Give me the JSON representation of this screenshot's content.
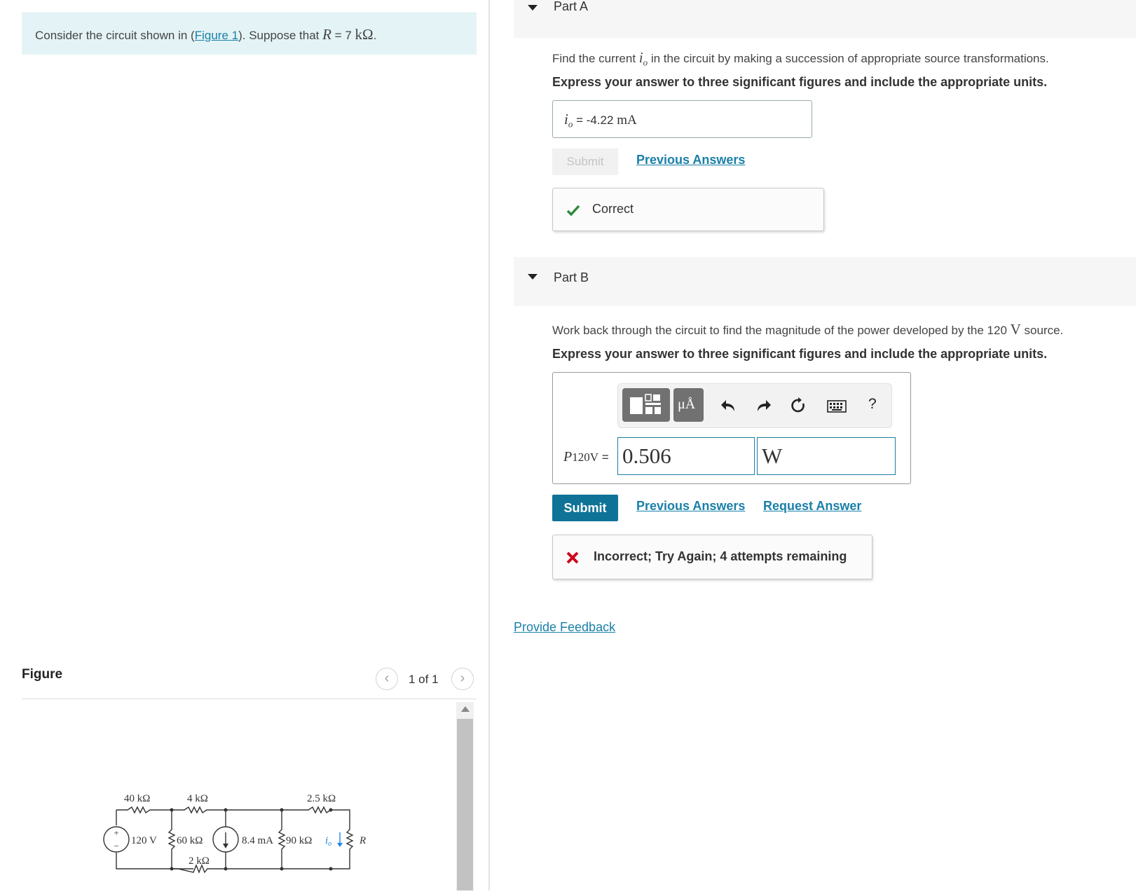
{
  "intro": {
    "text_before": "Consider the circuit shown in (",
    "figure_link": "Figure 1",
    "text_mid": "). Suppose that ",
    "var": "R",
    "text_eq": " = 7 ",
    "unit": "kΩ",
    "text_end": "."
  },
  "figure_panel": {
    "title": "Figure",
    "prev_icon": "chevron-left-icon",
    "next_icon": "chevron-right-icon",
    "counter": "1 of 1"
  },
  "circuit": {
    "r1": "40 kΩ",
    "r2": "4 kΩ",
    "r3": "2.5 kΩ",
    "vsrc": "120 V",
    "r4": "60 kΩ",
    "r5": "2 kΩ",
    "isrc": "8.4 mA",
    "r6": "90 kΩ",
    "io": "i",
    "io_sub": "o",
    "rload": "R"
  },
  "partA": {
    "title": "Part A",
    "question_before": "Find the current ",
    "question_var": "i",
    "question_sub": "o",
    "question_after": " in the circuit by making a succession of appropriate source transformations.",
    "instructions": "Express your answer to three significant figures and include the appropriate units.",
    "answer_var": "i",
    "answer_sub": "o",
    "answer_eq": " = ",
    "answer_value": "-4.22",
    "answer_unit": " mA",
    "submit_label": "Submit",
    "previous_answers": "Previous Answers",
    "feedback_icon": "checkmark-icon",
    "feedback": "Correct"
  },
  "partB": {
    "title": "Part B",
    "question_before": "Work back through the circuit to find the magnitude of the power developed by the 120 ",
    "question_unit": "V",
    "question_after": " source.",
    "instructions": "Express your answer to three significant figures and include the appropriate units.",
    "toolbar": {
      "templates_icon": "templates-icon",
      "units_label": "μÅ",
      "undo_icon": "undo-icon",
      "redo_icon": "redo-icon",
      "reset_icon": "reset-icon",
      "keyboard_icon": "keyboard-icon",
      "help_label": "?"
    },
    "answer_var": "P",
    "answer_sub": "120V",
    "answer_eq": " =",
    "value": "0.506",
    "unit": "W",
    "submit_label": "Submit",
    "previous_answers": "Previous Answers",
    "request_answer": "Request Answer",
    "feedback_icon": "x-icon",
    "feedback": "Incorrect; Try Again; 4 attempts remaining"
  },
  "provide_feedback": "Provide Feedback",
  "colors": {
    "link": "#1a7fa8",
    "submit": "#0f7397",
    "correct": "#2e8b3d",
    "incorrect": "#d0021b",
    "intro_bg": "#e4f4f6",
    "arrow": "#1e88e5"
  }
}
